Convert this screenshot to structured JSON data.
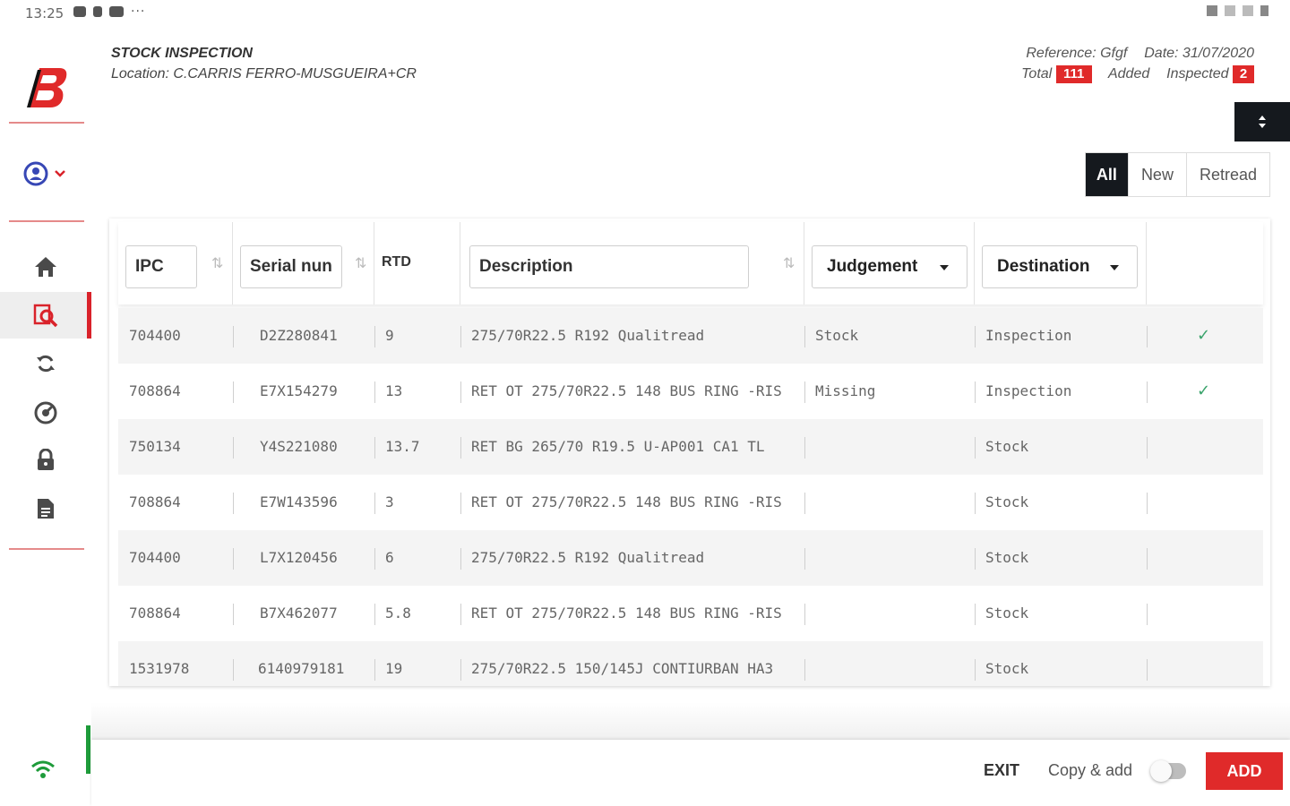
{
  "status_bar": {
    "time": "13:25",
    "more": "···"
  },
  "sidebar": {
    "logo_letter": "B",
    "brand_color": "#e02a2a",
    "nav": [
      "home-icon",
      "search-inspect-icon",
      "sync-icon",
      "settings-gauge-icon",
      "lock-icon",
      "document-icon"
    ]
  },
  "header": {
    "title": "STOCK INSPECTION",
    "location": "Location: C.CARRIS FERRO-MUSGUEIRA+CR",
    "reference": "Reference: Gfgf",
    "date": "Date: 31/07/2020",
    "total_label": "Total",
    "total_value": "111",
    "added_label": "Added",
    "inspected_label": "Inspected",
    "inspected_value": "2"
  },
  "filters": [
    "All",
    "New",
    "Retread"
  ],
  "table": {
    "headers": {
      "ipc": "IPC",
      "serial": "Serial nun",
      "rtd": "RTD",
      "description": "Description",
      "judgement": "Judgement",
      "destination": "Destination"
    },
    "rows": [
      {
        "ipc": "704400",
        "serial": "D2Z280841",
        "rtd": "9",
        "description": "275/70R22.5 R192 Qualitread",
        "judgement": "Stock",
        "destination": "Inspection",
        "checked": "✓"
      },
      {
        "ipc": "708864",
        "serial": "E7X154279",
        "rtd": "13",
        "description": "RET OT 275/70R22.5 148 BUS RING -RIS",
        "judgement": "Missing",
        "destination": "Inspection",
        "checked": "✓"
      },
      {
        "ipc": "750134",
        "serial": "Y4S221080",
        "rtd": "13.7",
        "description": "RET BG 265/70 R19.5 U-AP001 CA1 TL",
        "judgement": "",
        "destination": "Stock",
        "checked": ""
      },
      {
        "ipc": "708864",
        "serial": "E7W143596",
        "rtd": "3",
        "description": "RET OT 275/70R22.5 148 BUS RING -RIS",
        "judgement": "",
        "destination": "Stock",
        "checked": ""
      },
      {
        "ipc": "704400",
        "serial": "L7X120456",
        "rtd": "6",
        "description": "275/70R22.5 R192 Qualitread",
        "judgement": "",
        "destination": "Stock",
        "checked": ""
      },
      {
        "ipc": "708864",
        "serial": "B7X462077",
        "rtd": "5.8",
        "description": "RET OT 275/70R22.5 148 BUS RING -RIS",
        "judgement": "",
        "destination": "Stock",
        "checked": ""
      },
      {
        "ipc": "1531978",
        "serial": "6140979181",
        "rtd": "19",
        "description": "275/70R22.5 150/145J CONTIURBAN HA3",
        "judgement": "",
        "destination": "Stock",
        "checked": ""
      }
    ]
  },
  "footer": {
    "exit": "EXIT",
    "copy_add": "Copy & add",
    "add": "ADD"
  }
}
